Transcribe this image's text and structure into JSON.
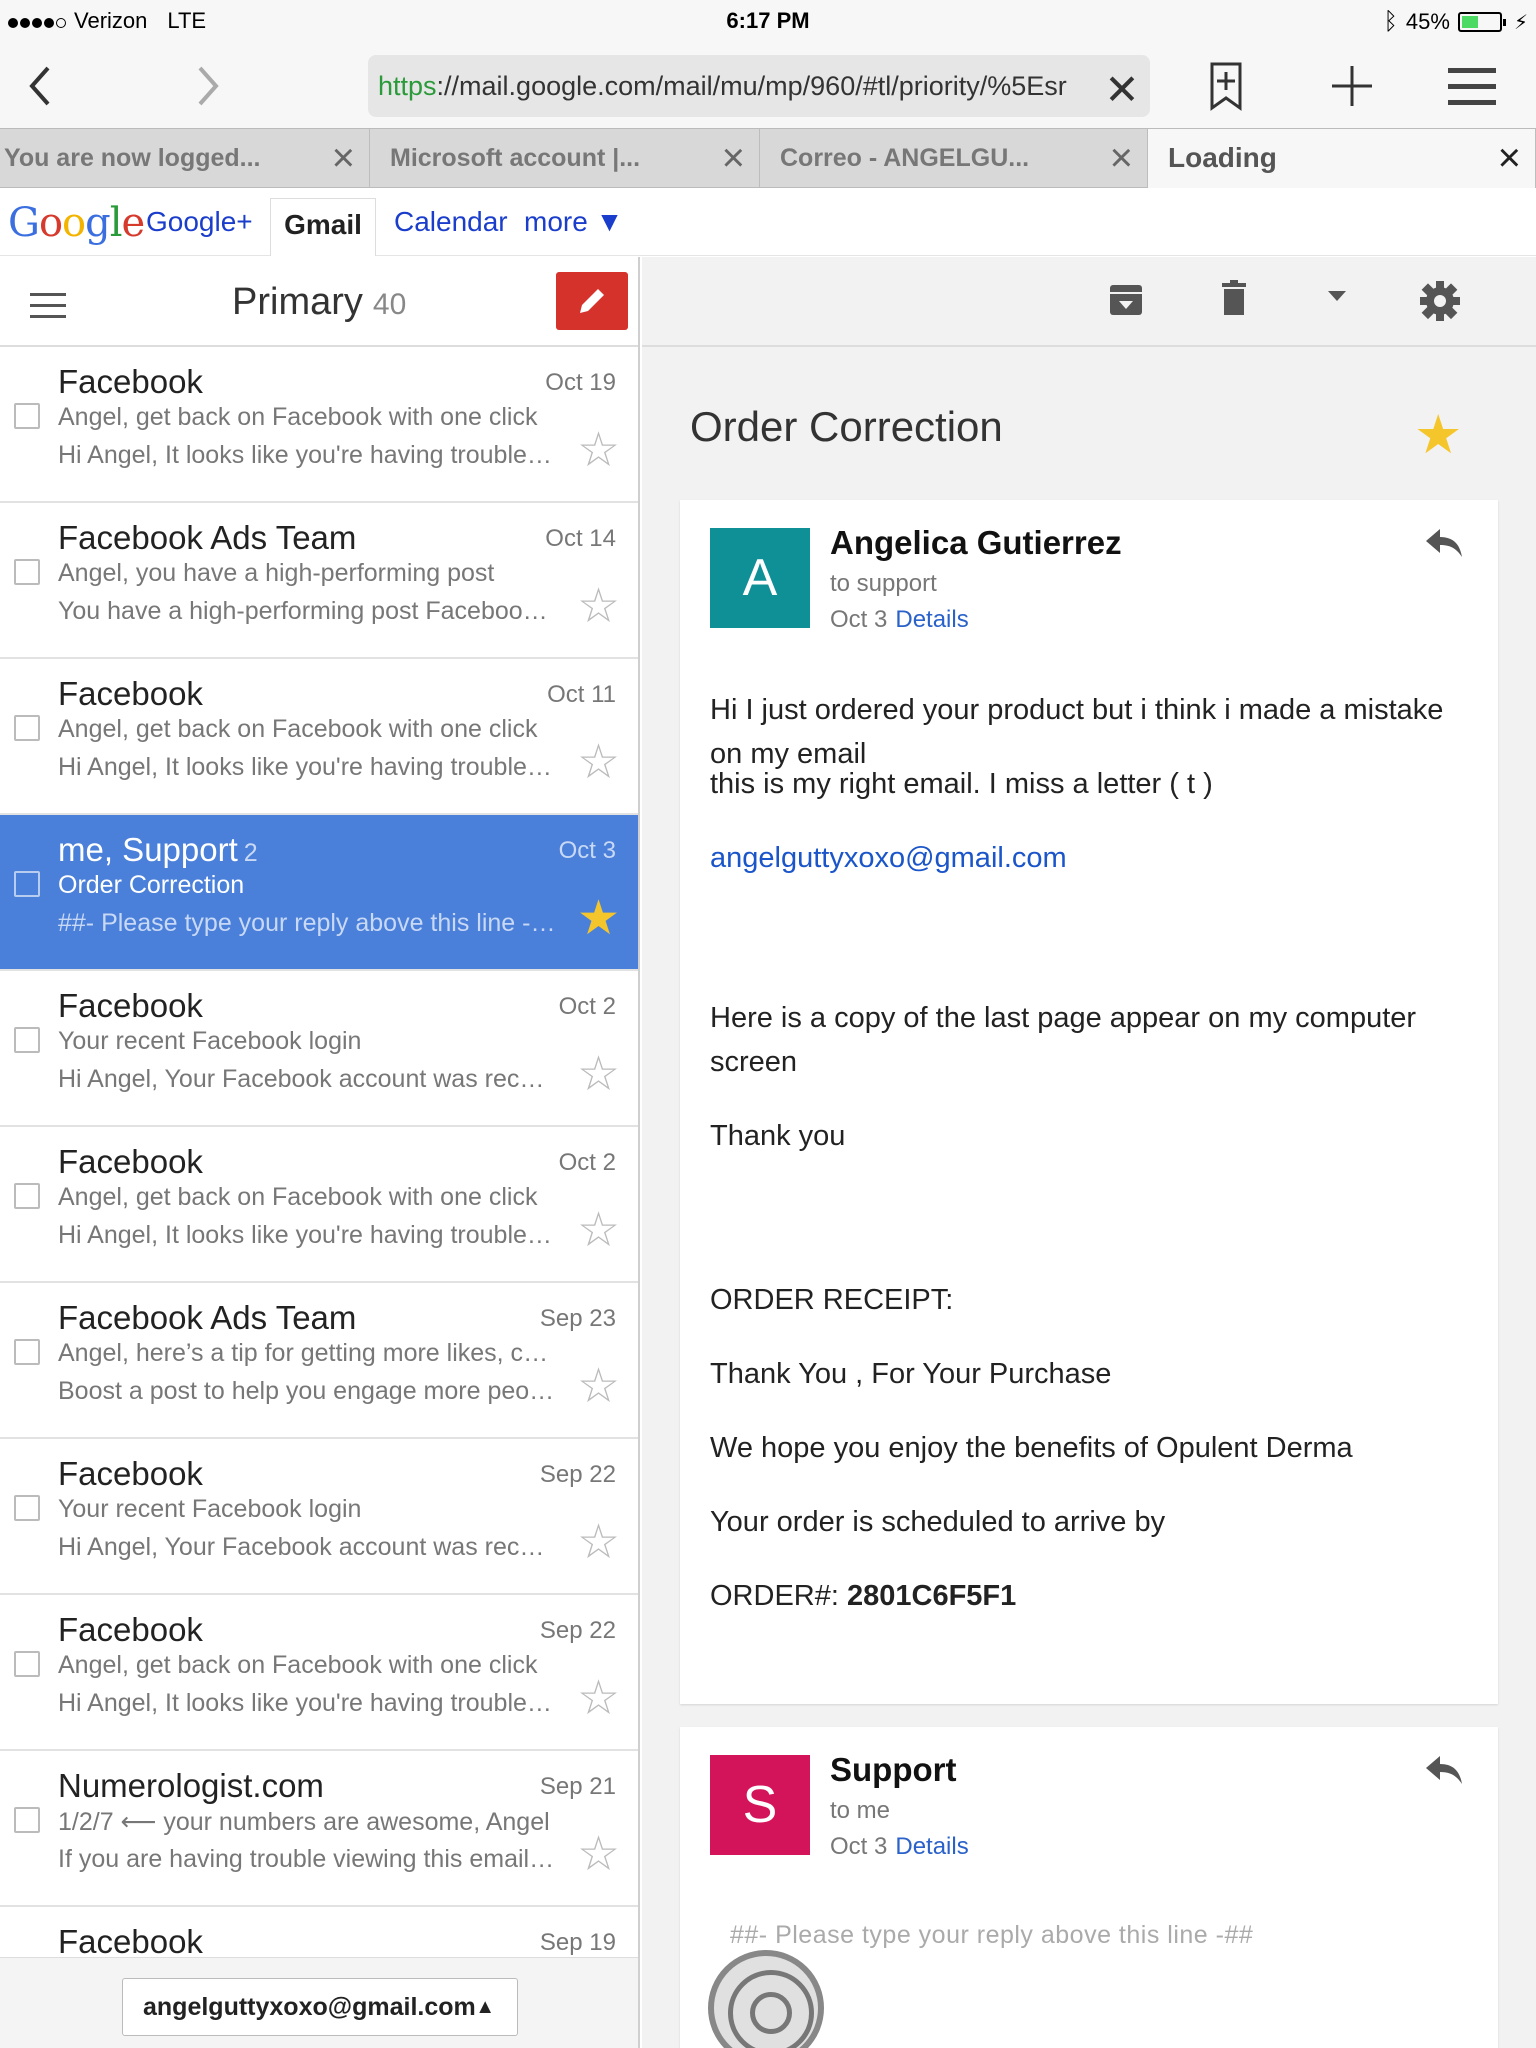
{
  "status_bar": {
    "carrier": "Verizon",
    "network": "LTE",
    "time": "6:17 PM",
    "battery": "45%",
    "battery_level": 0.45
  },
  "browser": {
    "url_scheme": "https",
    "url_rest": "://mail.google.com/mail/mu/mp/960/#tl/priority/%5Esr",
    "tabs": [
      {
        "title": "You are now logged..."
      },
      {
        "title": "Microsoft account |..."
      },
      {
        "title": "Correo - ANGELGU..."
      },
      {
        "title": "Loading"
      }
    ]
  },
  "google_bar": {
    "logo": "Google",
    "links": [
      "Google+",
      "Gmail",
      "Calendar",
      "more ▼"
    ]
  },
  "list": {
    "title": "Primary",
    "count": "40",
    "emails": [
      {
        "sender": "Facebook",
        "count": "",
        "date": "Oct 19",
        "subject": "Angel, get back on Facebook with one click",
        "snippet": "Hi Angel, It looks like you're having trouble logging in",
        "starred": false
      },
      {
        "sender": "Facebook Ads Team",
        "count": "",
        "date": "Oct 14",
        "subject": "Angel, you have a high-performing post",
        "snippet": "You have a high-performing post Facebook Ads Team",
        "starred": false
      },
      {
        "sender": "Facebook",
        "count": "",
        "date": "Oct 11",
        "subject": "Angel, get back on Facebook with one click",
        "snippet": "Hi Angel, It looks like you're having trouble logging in",
        "starred": false
      },
      {
        "sender": "me, Support",
        "count": "2",
        "date": "Oct 3",
        "subject": "Order Correction",
        "snippet": "##- Please type your reply above this line -##",
        "starred": true
      },
      {
        "sender": "Facebook",
        "count": "",
        "date": "Oct 2",
        "subject": "Your recent Facebook login",
        "snippet": "Hi Angel, Your Facebook account was recently logged into",
        "starred": false
      },
      {
        "sender": "Facebook",
        "count": "",
        "date": "Oct 2",
        "subject": "Angel, get back on Facebook with one click",
        "snippet": "Hi Angel, It looks like you're having trouble logging in",
        "starred": false
      },
      {
        "sender": "Facebook Ads Team",
        "count": "",
        "date": "Sep 23",
        "subject": "Angel, here’s a tip for getting more likes, comments",
        "snippet": "Boost a post to help you engage more people",
        "starred": false
      },
      {
        "sender": "Facebook",
        "count": "",
        "date": "Sep 22",
        "subject": "Your recent Facebook login",
        "snippet": "Hi Angel, Your Facebook account was recently logged into",
        "starred": false
      },
      {
        "sender": "Facebook",
        "count": "",
        "date": "Sep 22",
        "subject": "Angel, get back on Facebook with one click",
        "snippet": "Hi Angel, It looks like you're having trouble logging in",
        "starred": false
      },
      {
        "sender": "Numerologist.com",
        "count": "",
        "date": "Sep 21",
        "subject": "1/2/7 ⟵ your numbers are awesome, Angel",
        "snippet": "If you are having trouble viewing this email, click here",
        "starred": false
      },
      {
        "sender": "Facebook",
        "count": "",
        "date": "Sep 19",
        "subject": "",
        "snippet": "",
        "starred": false
      }
    ],
    "account": "angelguttyxoxo@gmail.com"
  },
  "thread": {
    "subject": "Order Correction",
    "messages": [
      {
        "avatar_letter": "A",
        "avatar_color": "#0f8f96",
        "from": "Angelica Gutierrez",
        "to": "to support",
        "date": "Oct 3",
        "details": "Details",
        "body": [
          "Hi I just ordered your product but i think i made a mistake on my email",
          "this is my right email.   I miss a letter  (  t  )",
          "angelguttyxoxo@gmail.com",
          "Here is a copy of the last page appear on my computer screen",
          "Thank you",
          "ORDER RECEIPT:",
          "Thank You , For Your Purchase",
          "We hope you enjoy the benefits of Opulent Derma",
          "Your order is scheduled to arrive by",
          "ORDER#: "
        ],
        "order_number": "2801C6F5F1"
      },
      {
        "avatar_letter": "S",
        "avatar_color": "#d4145a",
        "from": "Support",
        "to": "to me",
        "date": "Oct 3",
        "details": "Details",
        "body": [
          "##- Please type your reply above this line -##"
        ]
      }
    ]
  }
}
